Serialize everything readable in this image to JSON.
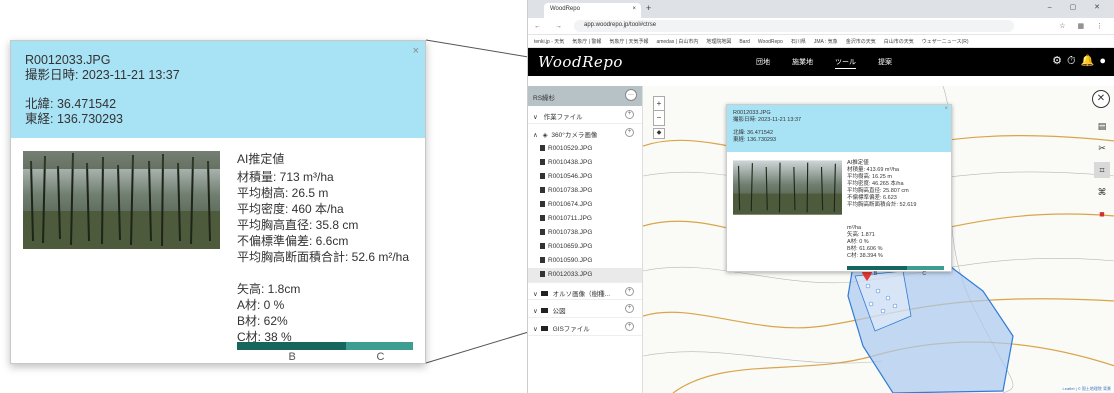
{
  "popup": {
    "filename": "R0012033.JPG",
    "datetime": "撮影日時: 2023-11-21 13:37",
    "latitude": "北緯: 36.471542",
    "longitude": "東経: 136.730293",
    "close": "×",
    "ai_title": "AI推定値",
    "ai_volume": "材積量: 713 m³/ha",
    "ai_height": "平均樹高: 26.5 m",
    "ai_density": "平均密度: 460 本/ha",
    "ai_dbh": "平均胸高直径: 35.8 cm",
    "ai_std": "不偏標準偏差: 6.6cm",
    "ai_basal": "平均胸高断面積合計: 52.6 m²/ha",
    "yaheight": "矢高: 1.8cm",
    "grade_a": "A材: 0 %",
    "grade_b": "B材: 62%",
    "grade_c": "C材: 38 %",
    "bar_label_b": "B",
    "bar_label_c": "C"
  },
  "grade_bar": {
    "B": 62,
    "C": 38
  },
  "mini_grade_bar": {
    "B": 61.606,
    "C": 38.394
  },
  "colors": {
    "popup_header": "#a8e2f5",
    "bar_b": "#17665e",
    "bar_c": "#3e9d93",
    "appbar": "#000000",
    "polygon": "#2f7bd6"
  },
  "browser": {
    "tab_title": "WoodRepo",
    "tab_close": "×",
    "new_tab": "+",
    "url": "app.woodrepo.jp/tool#ctrse",
    "bookmarks": [
      "tenki.jp - 天気",
      "気象庁 | 警報",
      "気象庁 | 天気予報",
      "amedas | 白山市内",
      "地理院地図",
      "Bard",
      "WoodRepo",
      "石川県",
      "JMA : 気象",
      "金沢市の天気",
      "白山市の天気",
      "ウェザーニュース(R)"
    ]
  },
  "app": {
    "logo": "WoodRepo",
    "nav": [
      "団地",
      "施業地",
      "ツール",
      "提案"
    ],
    "sidebar_title": "RS繰杉",
    "sidebar_more": "···",
    "folders": {
      "work": "作業ファイル",
      "camera360": "360°カメラ画像",
      "ortho": "オルソ画像（樹種...",
      "park": "公図",
      "gis": "GISファイル"
    },
    "plus": "+",
    "files": [
      "R0010529.JPG",
      "R0010438.JPG",
      "R0010546.JPG",
      "R0010738.JPG",
      "R0010674.JPG",
      "R0010711.JPG",
      "R0010738.JPG",
      "R0010659.JPG",
      "R0010590.JPG",
      "R0012033.JPG"
    ],
    "zoom_in": "+",
    "zoom_out": "−",
    "attribution": "Leaflet | © 国土地理院 背景"
  },
  "mini_popup": {
    "filename": "R0012033.JPG",
    "datetime": "撮影日時: 2023-11-21 13:37",
    "latitude": "北緯: 36.471542",
    "longitude": "東経: 136.730293",
    "close": "×",
    "ai_title": "AI推定値",
    "ai_volume": "材積量: 413.69 m³/ha",
    "ai_height": "平均樹高: 16.25 m",
    "ai_density": "平均密度: 46.265 本/ha",
    "ai_dbh": "平均胸高直径: 25.807 cm",
    "ai_std": "不偏標準偏差: 6.623",
    "ai_basal": "平均胸高断面積合計: 52.619",
    "ai_basal_unit": "m²/ha",
    "yaheight": "矢高: 1.871",
    "grade_a": "A材: 0 %",
    "grade_b": "B材: 61.606 %",
    "grade_c": "C材: 38.394 %",
    "bar_label_b": "B",
    "bar_label_c": "C"
  }
}
